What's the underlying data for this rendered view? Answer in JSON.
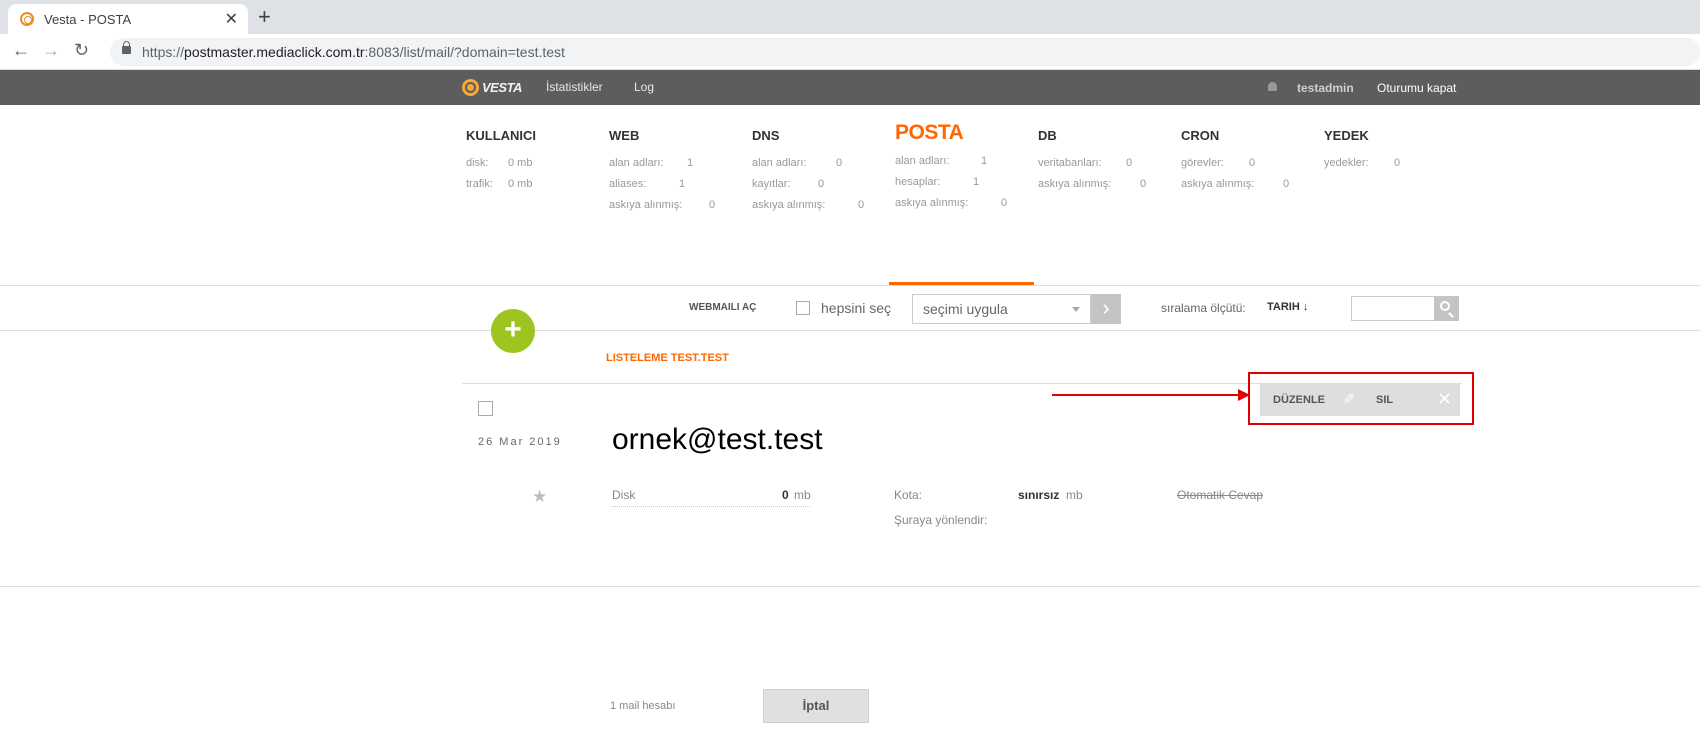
{
  "browser": {
    "tab_title": "Vesta - POSTA",
    "tab_close": "✕",
    "new_tab": "+",
    "back": "←",
    "forward": "→",
    "reload": "↻",
    "url_prefix": "https://",
    "url_host": "postmaster.mediaclick.com.tr",
    "url_path": ":8083/list/mail/?domain=test.test"
  },
  "topnav": {
    "logo": "VESTA",
    "links": [
      "İstatistikler",
      "Log"
    ],
    "user": "testadmin",
    "logout": "Oturumu kapat"
  },
  "stats": {
    "kullanici": {
      "title": "KULLANICI",
      "rows": [
        [
          "disk:",
          "0 mb"
        ],
        [
          "trafik:",
          "0 mb"
        ]
      ]
    },
    "web": {
      "title": "WEB",
      "rows": [
        [
          "alan adları:",
          "1"
        ],
        [
          "aliases:",
          "1"
        ],
        [
          "askıya alınmış:",
          "0"
        ]
      ]
    },
    "dns": {
      "title": "DNS",
      "rows": [
        [
          "alan adları:",
          "0"
        ],
        [
          "kayıtlar:",
          "0"
        ],
        [
          "askıya alınmış:",
          "0"
        ]
      ]
    },
    "posta": {
      "title": "POSTA",
      "rows": [
        [
          "alan adları:",
          "1"
        ],
        [
          "hesaplar:",
          "1"
        ],
        [
          "askıya alınmış:",
          "0"
        ]
      ]
    },
    "db": {
      "title": "DB",
      "rows": [
        [
          "veritabanları:",
          "0"
        ],
        [
          "askıya alınmış:",
          "0"
        ]
      ]
    },
    "cron": {
      "title": "CRON",
      "rows": [
        [
          "görevler:",
          "0"
        ],
        [
          "askıya alınmış:",
          "0"
        ]
      ]
    },
    "yedek": {
      "title": "YEDEK",
      "rows": [
        [
          "yedekler:",
          "0"
        ]
      ]
    }
  },
  "toolbar": {
    "add": "+",
    "webmail": "WEBMAILI AÇ",
    "select_all": "hepsini seç",
    "bulk_action": "seçimi uygula",
    "apply": "›",
    "sort_label": "sıralama ölçütü:",
    "sort_value": "TARIH ↓",
    "search_value": ""
  },
  "listing": {
    "title": "LISTELEME TEST.TEST",
    "count": "1 mail hesabı",
    "cancel": "İptal",
    "accounts": [
      {
        "date": "26 Mar 2019",
        "star": "★",
        "name": "ornek@test.test",
        "disk_label": "Disk",
        "disk_value": "0",
        "disk_unit": "mb",
        "quota_label": "Kota:",
        "quota_value": "sınırsız",
        "quota_unit": "mb",
        "autoreply": "Otomatik Cevap",
        "forward_label": "Şuraya yönlendir:",
        "actions": {
          "edit": "DÜZENLE",
          "edit_icon": "✎",
          "delete": "SIL",
          "delete_icon": "✕"
        }
      }
    ]
  },
  "annotation": {
    "color": "#e00000"
  },
  "colors": {
    "accent": "#ff6701",
    "add_button": "#9dc41f",
    "topnav": "#5d5d5d"
  }
}
